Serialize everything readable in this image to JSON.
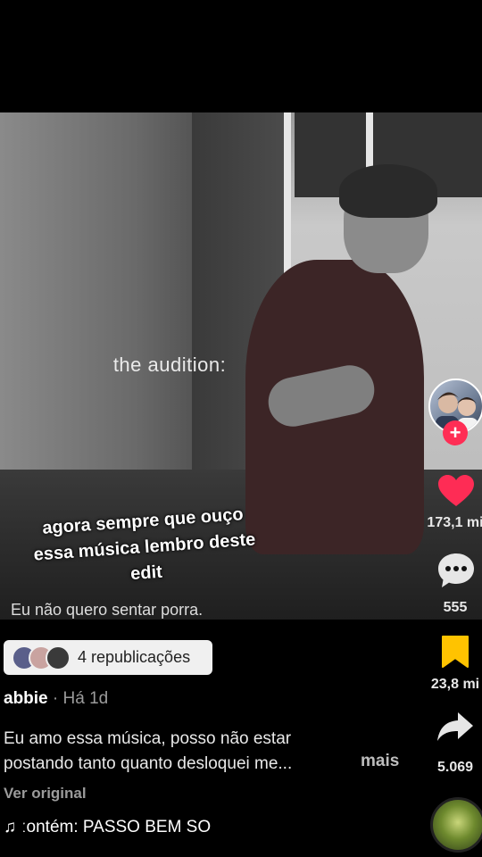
{
  "video": {
    "overlay_text": "the audition:",
    "caption_sticker": [
      "agora sempre que ouço",
      "essa música lembro deste",
      "edit"
    ],
    "subtitle": "Eu não quero sentar porra."
  },
  "actions": {
    "likes": "173,1 mi",
    "comments": "555",
    "saves": "23,8 mi",
    "shares": "5.069",
    "follow_symbol": "+",
    "like_color": "#fe2c55",
    "save_color": "#ffc300"
  },
  "reposts": {
    "label": "4 republicações"
  },
  "post": {
    "author": "abbie",
    "time": "· Há 1d",
    "description": [
      "Eu amo essa música, posso não estar",
      "postando tanto quanto desloquei me..."
    ],
    "more_label": "mais",
    "see_original": "Ver original",
    "music_icon": "♫",
    "music": "ːontém: PASSO BEM SO"
  }
}
